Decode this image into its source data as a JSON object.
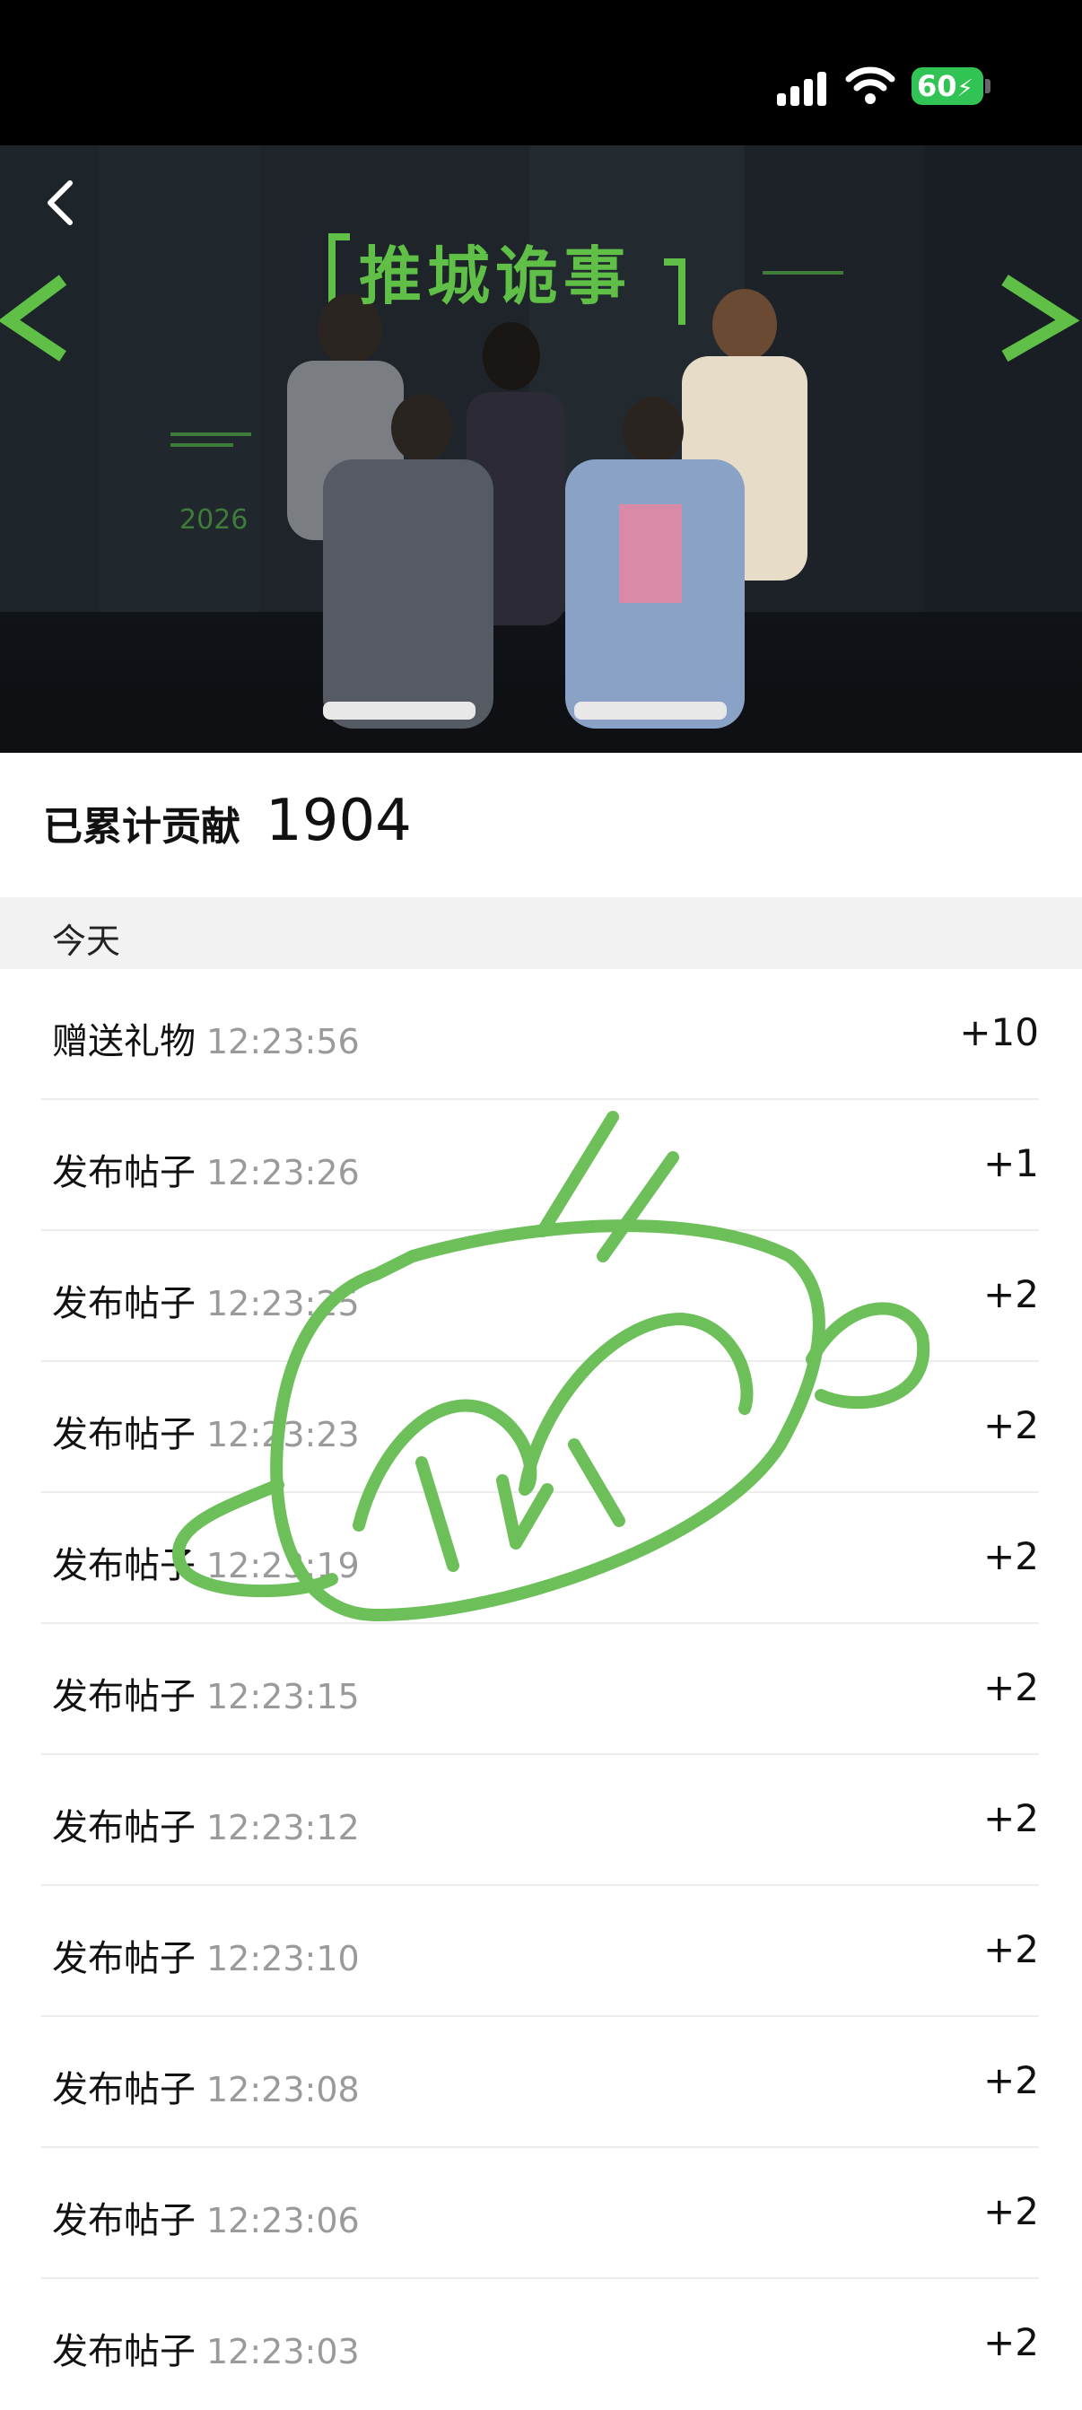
{
  "status_bar": {
    "battery": "60"
  },
  "hero": {
    "sign_text": "推城诡事",
    "year_text": "2026"
  },
  "summary": {
    "label": "已累计贡献",
    "value": "1904"
  },
  "section": {
    "date_header": "今天"
  },
  "records": [
    {
      "action": "赠送礼物",
      "time": "12:23:56",
      "points": "+10"
    },
    {
      "action": "发布帖子",
      "time": "12:23:26",
      "points": "+1"
    },
    {
      "action": "发布帖子",
      "time": "12:23:25",
      "points": "+2"
    },
    {
      "action": "发布帖子",
      "time": "12:23:23",
      "points": "+2"
    },
    {
      "action": "发布帖子",
      "time": "12:23:19",
      "points": "+2"
    },
    {
      "action": "发布帖子",
      "time": "12:23:15",
      "points": "+2"
    },
    {
      "action": "发布帖子",
      "time": "12:23:12",
      "points": "+2"
    },
    {
      "action": "发布帖子",
      "time": "12:23:10",
      "points": "+2"
    },
    {
      "action": "发布帖子",
      "time": "12:23:08",
      "points": "+2"
    },
    {
      "action": "发布帖子",
      "time": "12:23:06",
      "points": "+2"
    },
    {
      "action": "发布帖子",
      "time": "12:23:03",
      "points": "+2"
    }
  ],
  "colors": {
    "accent_green": "#6cbf59",
    "status_bg": "#000000",
    "battery_green": "#31c454"
  },
  "icons": {
    "back": "chevron-left-icon",
    "signal": "cellular-signal-icon",
    "wifi": "wifi-icon",
    "battery": "battery-charging-icon"
  }
}
